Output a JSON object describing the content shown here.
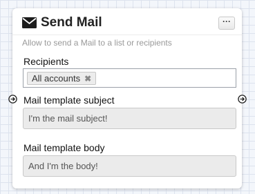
{
  "node": {
    "title": "Send Mail",
    "subtitle": "Allow to send a Mail to a list or recipients",
    "more_button_label": "···",
    "title_icon": "envelope-icon",
    "more_icon": "ellipsis-icon"
  },
  "fields": {
    "recipients": {
      "label": "Recipients",
      "tags": [
        "All accounts"
      ],
      "tag_remove_glyph": "✖"
    },
    "subject": {
      "label": "Mail template subject",
      "value": "I'm the mail subject!"
    },
    "body": {
      "label": "Mail template body",
      "value": "And I'm the body!"
    }
  },
  "connectors": {
    "input_icon": "arrow-right-circle-icon",
    "output_icon": "arrow-right-circle-icon"
  }
}
